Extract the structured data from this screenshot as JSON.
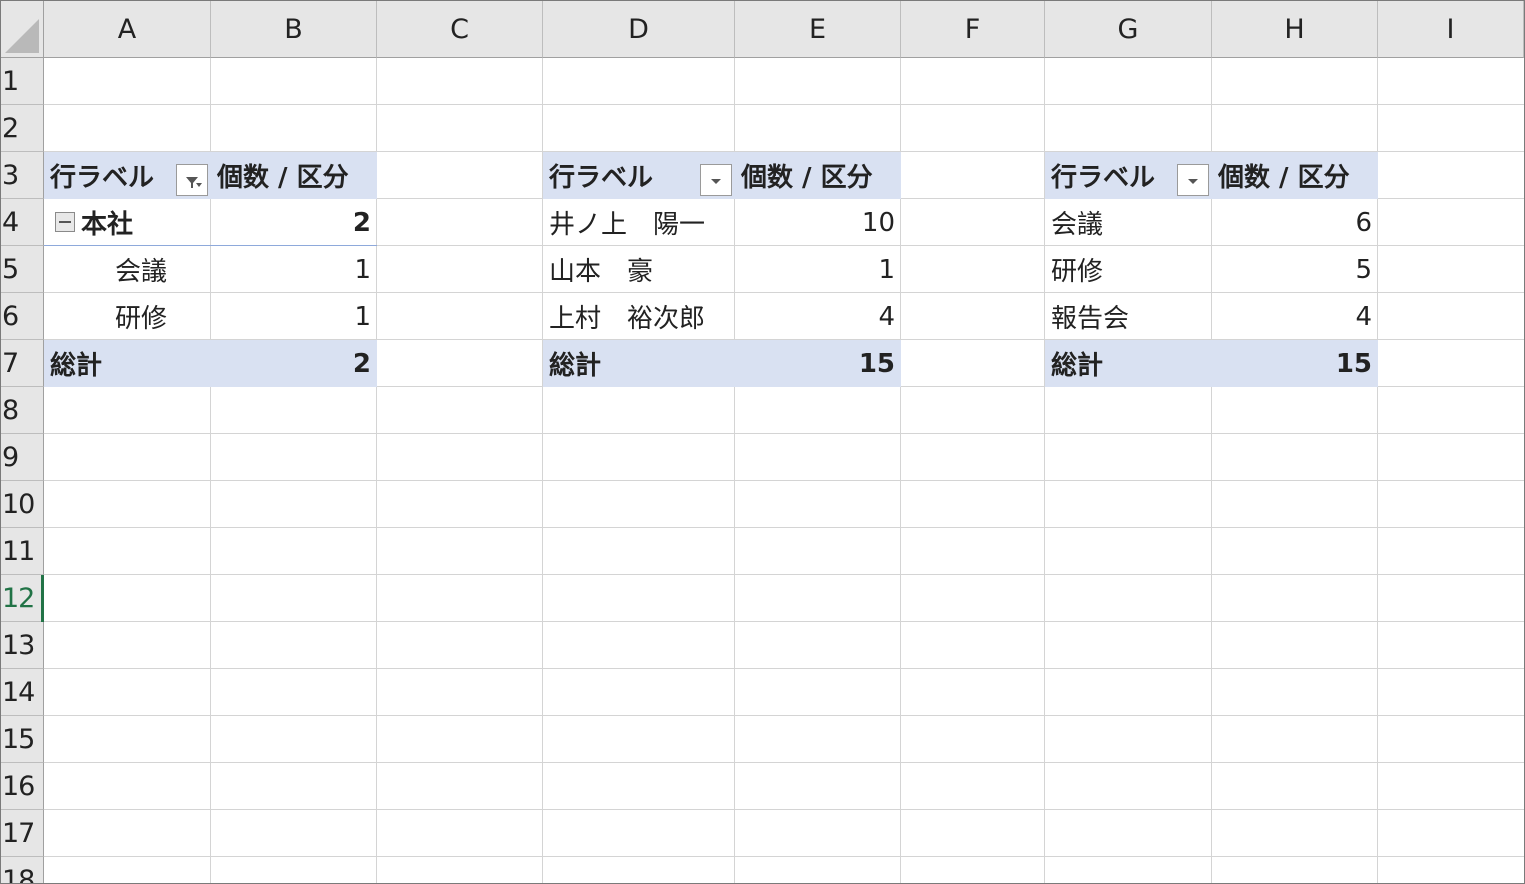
{
  "columns": [
    "A",
    "B",
    "C",
    "D",
    "E",
    "F",
    "G",
    "H",
    "I"
  ],
  "rows": [
    "1",
    "2",
    "3",
    "4",
    "5",
    "6",
    "7",
    "8",
    "9",
    "10",
    "11",
    "12",
    "13",
    "14",
    "15",
    "16",
    "17",
    "18"
  ],
  "active_row": "12",
  "pivot1": {
    "row_label_header": "行ラベル",
    "value_header": "個数 / 区分",
    "group": {
      "label": "本社",
      "value": "2"
    },
    "items": [
      {
        "label": "会議",
        "value": "1"
      },
      {
        "label": "研修",
        "value": "1"
      }
    ],
    "total": {
      "label": "総計",
      "value": "2"
    }
  },
  "pivot2": {
    "row_label_header": "行ラベル",
    "value_header": "個数 / 区分",
    "items": [
      {
        "label": "井ノ上　陽一",
        "value": "10"
      },
      {
        "label": "山本　豪",
        "value": "1"
      },
      {
        "label": "上村　裕次郎",
        "value": "4"
      }
    ],
    "total": {
      "label": "総計",
      "value": "15"
    }
  },
  "pivot3": {
    "row_label_header": "行ラベル",
    "value_header": "個数 / 区分",
    "items": [
      {
        "label": "会議",
        "value": "6"
      },
      {
        "label": "研修",
        "value": "5"
      },
      {
        "label": "報告会",
        "value": "4"
      }
    ],
    "total": {
      "label": "総計",
      "value": "15"
    }
  },
  "colors": {
    "pivot_header_band": "#d9e1f2",
    "active_accent": "#217346"
  }
}
